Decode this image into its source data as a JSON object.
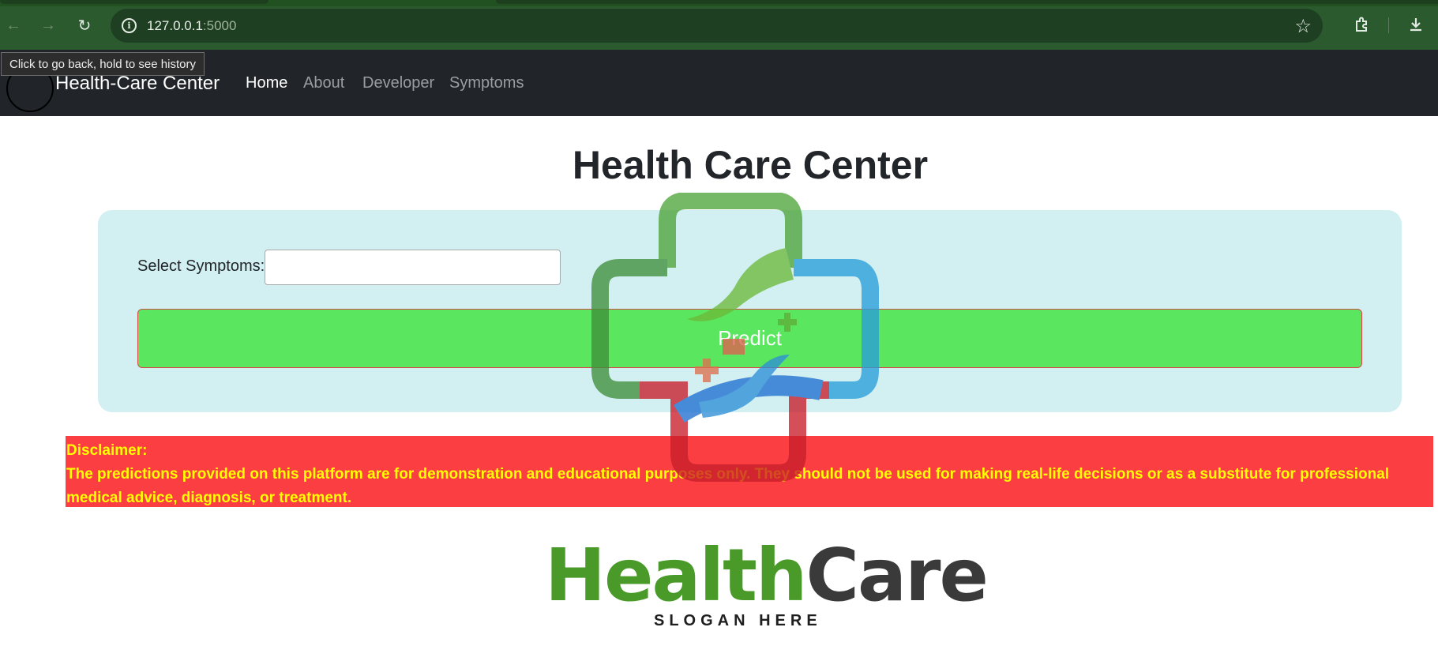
{
  "browser": {
    "url_host": "127.0.0.1",
    "url_port": ":5000",
    "tooltip": "Click to go back, hold to see history"
  },
  "navbar": {
    "brand": "Health-Care Center",
    "links": [
      {
        "label": "Home",
        "active": true
      },
      {
        "label": "About",
        "active": false
      },
      {
        "label": "Developer",
        "active": false
      },
      {
        "label": "Symptoms",
        "active": false
      }
    ]
  },
  "main": {
    "title": "Health Care Center",
    "symptoms_label": "Select Symptoms:",
    "symptoms_value": "",
    "predict_label": "Predict"
  },
  "disclaimer": {
    "heading": "Disclaimer:",
    "text": "The predictions provided on this platform are for demonstration and educational purposes only. They should not be used for making real-life decisions or as a substitute for professional medical advice, diagnosis, or treatment."
  },
  "logo": {
    "word_green": "Health",
    "word_dark": "Care",
    "slogan": "SLOGAN HERE"
  },
  "colors": {
    "chrome": "#2b5a2f",
    "navbar": "#212529",
    "card": "#d2eff2",
    "predict": "#5ae65e",
    "disclaimer_bg": "#fb3e42",
    "disclaimer_text": "#ffff00"
  }
}
